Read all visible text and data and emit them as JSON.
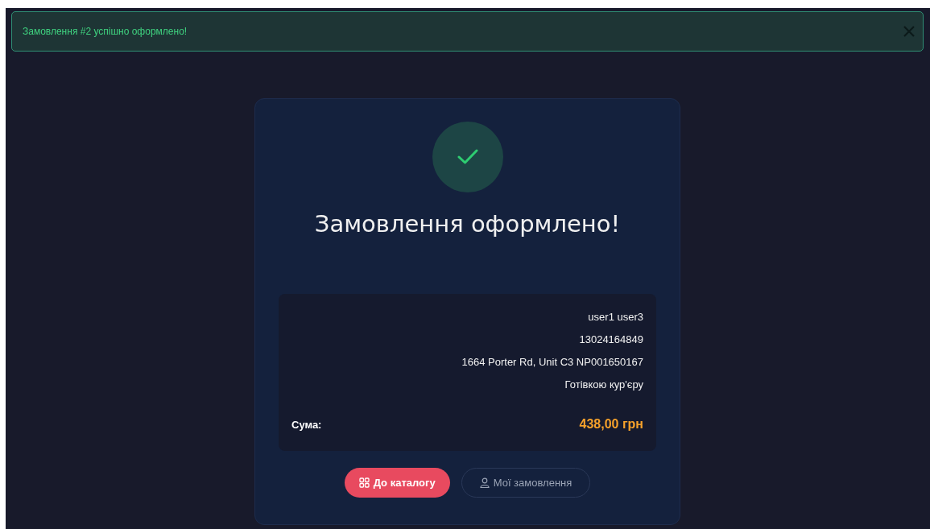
{
  "toast": {
    "message": "Замовлення #2 успішно оформлено!"
  },
  "card": {
    "title": "Замовлення оформлено!",
    "details": [
      "user1 user3",
      "13024164849",
      "1664 Porter Rd, Unit C3 NP001650167",
      "Готівкою кур'єру"
    ],
    "total": {
      "label": "Сума:",
      "value": "438,00 грн"
    },
    "buttons": [
      {
        "label": "До каталогу",
        "kind": "primary"
      },
      {
        "label": "Мої замовлення",
        "kind": "secondary"
      }
    ]
  }
}
